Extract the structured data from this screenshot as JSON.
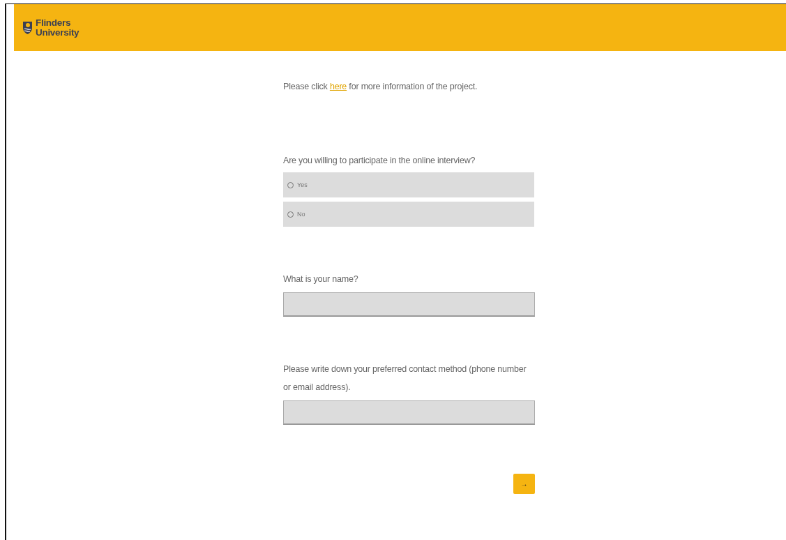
{
  "header": {
    "logo_lines": [
      "Flinders",
      "University"
    ]
  },
  "intro": {
    "before": "Please click ",
    "link": "here",
    "after": " for more information of the project."
  },
  "questions": [
    {
      "kind": "radio",
      "text": "Are you willing to participate in the online interview?",
      "options": [
        {
          "label": "Yes",
          "selected": false
        },
        {
          "label": "No",
          "selected": false
        }
      ]
    },
    {
      "kind": "text",
      "text": "What is your name?"
    },
    {
      "kind": "text",
      "text": "Please write down your preferred contact method (phone number or email address)."
    }
  ],
  "next_button": {
    "label": "→"
  }
}
